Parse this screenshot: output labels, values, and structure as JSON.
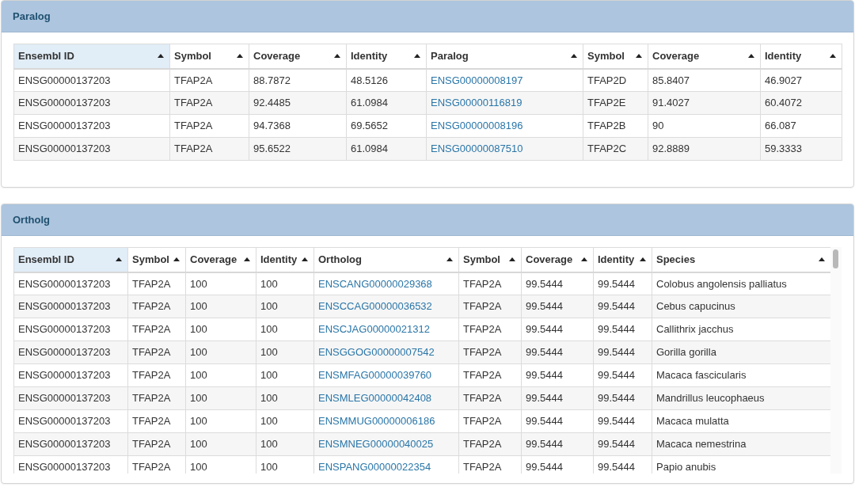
{
  "panels": [
    {
      "title": "Paralog",
      "scrollable": false,
      "columns": [
        {
          "label": "Ensembl ID",
          "sorted": true,
          "kind": "text"
        },
        {
          "label": "Symbol",
          "sorted": false,
          "kind": "text"
        },
        {
          "label": "Coverage",
          "sorted": false,
          "kind": "text"
        },
        {
          "label": "Identity",
          "sorted": false,
          "kind": "text"
        },
        {
          "label": "Paralog",
          "sorted": false,
          "kind": "link"
        },
        {
          "label": "Symbol",
          "sorted": false,
          "kind": "text"
        },
        {
          "label": "Coverage",
          "sorted": false,
          "kind": "text"
        },
        {
          "label": "Identity",
          "sorted": false,
          "kind": "text"
        }
      ],
      "rows": [
        [
          "ENSG00000137203",
          "TFAP2A",
          "88.7872",
          "48.5126",
          "ENSG00000008197",
          "TFAP2D",
          "85.8407",
          "46.9027"
        ],
        [
          "ENSG00000137203",
          "TFAP2A",
          "92.4485",
          "61.0984",
          "ENSG00000116819",
          "TFAP2E",
          "91.4027",
          "60.4072"
        ],
        [
          "ENSG00000137203",
          "TFAP2A",
          "94.7368",
          "69.5652",
          "ENSG00000008196",
          "TFAP2B",
          "90",
          "66.087"
        ],
        [
          "ENSG00000137203",
          "TFAP2A",
          "95.6522",
          "61.0984",
          "ENSG00000087510",
          "TFAP2C",
          "92.8889",
          "59.3333"
        ]
      ]
    },
    {
      "title": "Ortholg",
      "scrollable": true,
      "columns": [
        {
          "label": "Ensembl ID",
          "sorted": true,
          "kind": "text"
        },
        {
          "label": "Symbol",
          "sorted": false,
          "kind": "text"
        },
        {
          "label": "Coverage",
          "sorted": false,
          "kind": "text"
        },
        {
          "label": "Identity",
          "sorted": false,
          "kind": "text"
        },
        {
          "label": "Ortholog",
          "sorted": false,
          "kind": "link"
        },
        {
          "label": "Symbol",
          "sorted": false,
          "kind": "text"
        },
        {
          "label": "Coverage",
          "sorted": false,
          "kind": "text"
        },
        {
          "label": "Identity",
          "sorted": false,
          "kind": "text"
        },
        {
          "label": "Species",
          "sorted": false,
          "kind": "text"
        }
      ],
      "rows": [
        [
          "ENSG00000137203",
          "TFAP2A",
          "100",
          "100",
          "ENSCANG00000029368",
          "TFAP2A",
          "99.5444",
          "99.5444",
          "Colobus angolensis palliatus"
        ],
        [
          "ENSG00000137203",
          "TFAP2A",
          "100",
          "100",
          "ENSCCAG00000036532",
          "TFAP2A",
          "99.5444",
          "99.5444",
          "Cebus capucinus"
        ],
        [
          "ENSG00000137203",
          "TFAP2A",
          "100",
          "100",
          "ENSCJAG00000021312",
          "TFAP2A",
          "99.5444",
          "99.5444",
          "Callithrix jacchus"
        ],
        [
          "ENSG00000137203",
          "TFAP2A",
          "100",
          "100",
          "ENSGGOG00000007542",
          "TFAP2A",
          "99.5444",
          "99.5444",
          "Gorilla gorilla"
        ],
        [
          "ENSG00000137203",
          "TFAP2A",
          "100",
          "100",
          "ENSMFAG00000039760",
          "TFAP2A",
          "99.5444",
          "99.5444",
          "Macaca fascicularis"
        ],
        [
          "ENSG00000137203",
          "TFAP2A",
          "100",
          "100",
          "ENSMLEG00000042408",
          "TFAP2A",
          "99.5444",
          "99.5444",
          "Mandrillus leucophaeus"
        ],
        [
          "ENSG00000137203",
          "TFAP2A",
          "100",
          "100",
          "ENSMMUG00000006186",
          "TFAP2A",
          "99.5444",
          "99.5444",
          "Macaca mulatta"
        ],
        [
          "ENSG00000137203",
          "TFAP2A",
          "100",
          "100",
          "ENSMNEG00000040025",
          "TFAP2A",
          "99.5444",
          "99.5444",
          "Macaca nemestrina"
        ],
        [
          "ENSG00000137203",
          "TFAP2A",
          "100",
          "100",
          "ENSPANG00000022354",
          "TFAP2A",
          "99.5444",
          "99.5444",
          "Papio anubis"
        ]
      ]
    }
  ]
}
